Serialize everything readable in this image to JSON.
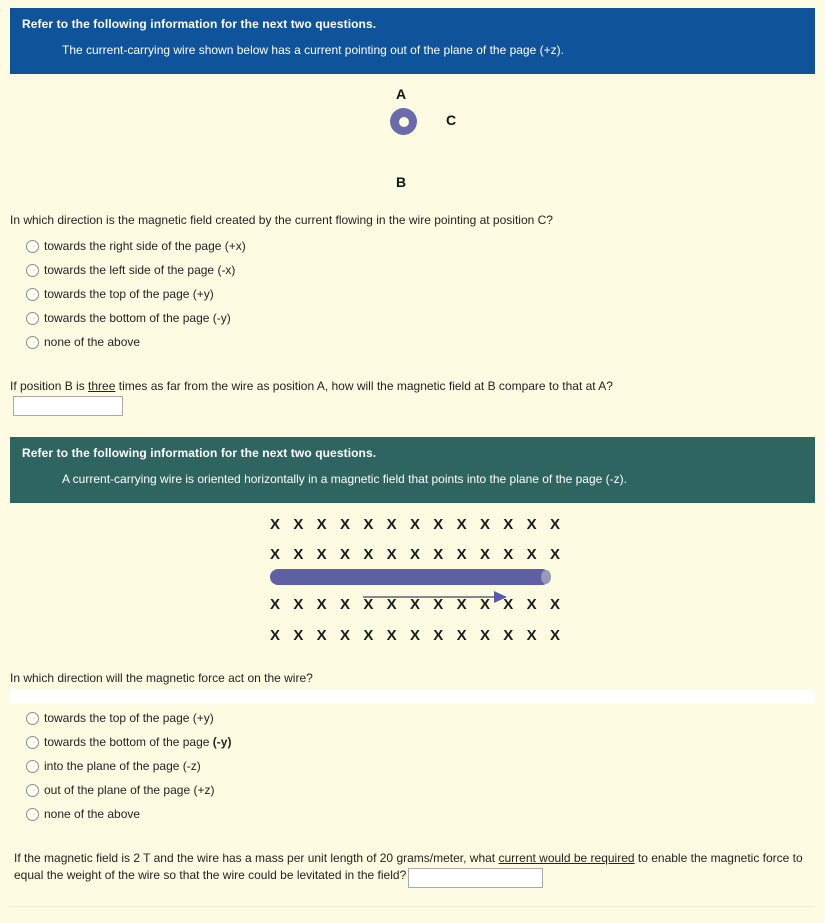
{
  "theme": {
    "page_background": "#fdfce2",
    "banner_blue": "#0f539b",
    "banner_teal": "#2e6560",
    "wire_purple": "#5f5fa3",
    "text_color": "#232323"
  },
  "block1": {
    "banner": {
      "title": "Refer to the following information for the next two questions.",
      "body": "The current-carrying wire shown below has a current pointing out of the plane of the page (+z)."
    },
    "diagram": {
      "label_a": "A",
      "label_b": "B",
      "label_c": "C",
      "wire_symbol": "current-out-of-page-dot"
    },
    "question1": {
      "text": "In which direction is the magnetic field created by the current flowing in the wire pointing at position C?",
      "options": [
        "towards the right side of the page (+x)",
        "towards the left side of the page (-x)",
        "towards the top of the page (+y)",
        "towards the bottom of the page (-y)",
        "none of the above"
      ]
    },
    "question2": {
      "text_before": "If position B is ",
      "text_underlined": "three",
      "text_after": " times as far from the wire as position A, how will the magnetic field at B compare to that at A?",
      "answer_value": "",
      "answer_placeholder": ""
    }
  },
  "block2": {
    "banner": {
      "title": "Refer to the following information for the next two questions.",
      "body": "A current-carrying wire is oriented horizontally in a magnetic field that points into the plane of the page (-z)."
    },
    "diagram": {
      "field_marker": "X",
      "markers_per_row": 13,
      "rows_above_wire": 2,
      "rows_below_wire": 2,
      "wire_symbol": "horizontal-wire-bar",
      "current_arrow_direction": "right"
    },
    "question3": {
      "text": "In which direction will the magnetic force act on the wire?",
      "options": [
        {
          "prefix": "towards the top of the page (+y)",
          "bold": ""
        },
        {
          "prefix": "towards the bottom of the page ",
          "bold": "(-y)"
        },
        {
          "prefix": "into the plane of the page (-z)",
          "bold": ""
        },
        {
          "prefix": "out of the plane of the page (+z)",
          "bold": ""
        },
        {
          "prefix": "none of the above",
          "bold": ""
        }
      ]
    },
    "question4": {
      "part1": "If the magnetic field is 2 T and the wire has a mass per unit length of 20 grams/meter, what ",
      "part_underlined": "current would be required",
      "part2": " to enable the magnetic force to equal the weight of the wire so that the wire could be levitated in the field?",
      "answer_value": "",
      "answer_placeholder": ""
    }
  }
}
